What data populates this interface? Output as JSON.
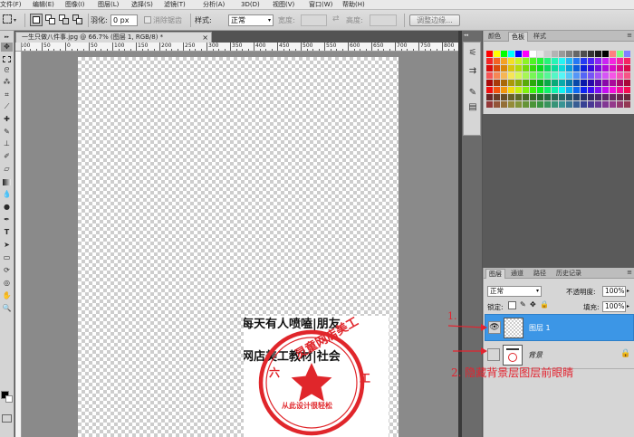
{
  "menubar": {
    "items": [
      "文件(F)",
      "编辑(E)",
      "图像(I)",
      "图层(L)",
      "选择(S)",
      "滤镜(T)",
      "分析(A)",
      "3D(D)",
      "视图(V)",
      "窗口(W)",
      "帮助(H)"
    ]
  },
  "options": {
    "feather_label": "羽化:",
    "feather_value": "0 px",
    "antialias_label": "消除锯齿",
    "style_label": "样式:",
    "style_value": "正常",
    "width_label": "宽度:",
    "height_label": "高度:",
    "refine_edge_label": "调整边缘..."
  },
  "document": {
    "tab_title": "一生只做八件事.jpg @ 66.7% (图层 1, RGB/8) *",
    "tab_close": "×",
    "ruler_ticks": [
      "100",
      "50",
      "0",
      "50",
      "100",
      "150",
      "200",
      "250",
      "300",
      "350",
      "400",
      "450",
      "500",
      "550",
      "600",
      "650",
      "700",
      "750",
      "800",
      "850"
    ]
  },
  "image": {
    "line1": "每天有人喷嗑|朋友",
    "line2": "网店美工教材|社会",
    "seal_top": "灵童网店美工",
    "seal_bottom": "从此设计很轻松",
    "seal_left": "六",
    "seal_right": "工",
    "seal_color": "#e0262b"
  },
  "swatches_panel": {
    "tabs": [
      "颜色",
      "色板",
      "样式"
    ],
    "active_tab": "色板"
  },
  "layers_panel": {
    "tabs": [
      "图层",
      "通道",
      "路径",
      "历史记录"
    ],
    "blend_mode": "正常",
    "opacity_label": "不透明度:",
    "opacity_value": "100%",
    "lock_label": "锁定:",
    "fill_label": "填充:",
    "fill_value": "100%",
    "layers": [
      {
        "name": "图层 1",
        "visible": true,
        "selected": true
      },
      {
        "name": "背景",
        "visible": false,
        "selected": false
      }
    ]
  },
  "annotations": {
    "step1": "1.",
    "step2": "2. 隐藏背景层图层前眼睛",
    "color": "#e3232f"
  },
  "colors": {
    "selection_blue": "#3c96e6",
    "panel_gray": "#d6d6d6",
    "workspace_gray": "#535353"
  }
}
